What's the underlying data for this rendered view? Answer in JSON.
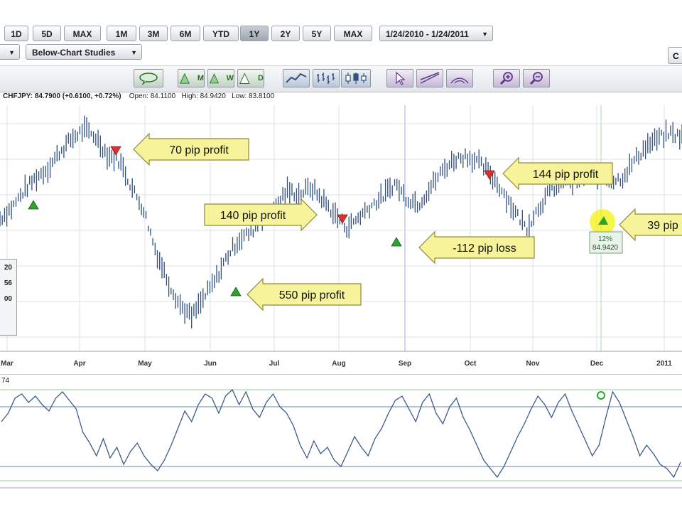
{
  "range_buttons": [
    "1D",
    "5D",
    "MAX",
    "1M",
    "3M",
    "6M",
    "YTD",
    "1Y",
    "2Y",
    "5Y",
    "MAX"
  ],
  "active_range": "1Y",
  "date_range": "1/24/2010 - 1/24/2011",
  "studies_dropdown": "Below-Chart Studies",
  "corner_tab": "C",
  "toolbar": {
    "m": "M",
    "w": "W",
    "d": "D"
  },
  "quote": {
    "symbol": "CHFJPY: 84.7900 (+0.6100, +0.72%)",
    "open": "Open: 84.1100",
    "high": "High: 84.9420",
    "low": "Low: 83.8100"
  },
  "left_panel": [
    "20",
    "56",
    "00"
  ],
  "osc_label": "74",
  "colors": {
    "price": "#2f4f7f",
    "buy": "#2aa52a",
    "sell": "#d93030",
    "callout": "#f6f39a",
    "grid": "#dde3ea",
    "cursor": "#b8b8e8",
    "osc": "#3a5a8a"
  },
  "chart_data": {
    "type": "line",
    "x_ticks": [
      "Mar",
      "Apr",
      "May",
      "Jun",
      "Jul",
      "Aug",
      "Sep",
      "Oct",
      "Nov",
      "Dec",
      "2011"
    ],
    "price_series": [
      82.9,
      83.5,
      84.4,
      85.1,
      85.6,
      86.5,
      87.2,
      87.7,
      87.3,
      86.3,
      86.0,
      84.6,
      83.4,
      81.2,
      79.6,
      78.3,
      77.6,
      78.6,
      79.6,
      80.9,
      81.8,
      82.2,
      83.0,
      83.6,
      84.4,
      84.2,
      84.6,
      83.9,
      83.1,
      82.4,
      83.0,
      83.6,
      84.1,
      84.8,
      84.0,
      83.7,
      84.6,
      85.5,
      86.1,
      86.3,
      85.9,
      85.3,
      84.4,
      83.3,
      82.4,
      83.5,
      84.4,
      84.9,
      84.8,
      85.3,
      85.2,
      84.9,
      85.1,
      86.0,
      86.8,
      87.2,
      87.5,
      87.3
    ],
    "oscillator_series": [
      62,
      70,
      84,
      88,
      80,
      86,
      78,
      72,
      84,
      90,
      82,
      74,
      52,
      42,
      30,
      46,
      28,
      38,
      22,
      34,
      42,
      30,
      22,
      16,
      26,
      40,
      56,
      72,
      62,
      78,
      88,
      84,
      70,
      86,
      92,
      78,
      90,
      74,
      66,
      80,
      88,
      76,
      70,
      58,
      40,
      28,
      44,
      32,
      38,
      26,
      20,
      34,
      48,
      38,
      30,
      46,
      56,
      70,
      82,
      86,
      74,
      62,
      80,
      88,
      70,
      60,
      76,
      84,
      66,
      54,
      40,
      26,
      18,
      10,
      20,
      34,
      48,
      60,
      74,
      86,
      78,
      66,
      80,
      88,
      72,
      58,
      44,
      30,
      40,
      66,
      90,
      80,
      64,
      48,
      30,
      40,
      32,
      22,
      18,
      10,
      24
    ],
    "annotations": [
      {
        "text": "70 pip profit",
        "signal": "sell",
        "direction": "left"
      },
      {
        "text": "140 pip profit",
        "signal": "sell",
        "direction": "right"
      },
      {
        "text": "550 pip profit",
        "signal": "buy",
        "direction": "left"
      },
      {
        "text": "-112 pip loss",
        "signal": "buy",
        "direction": "left"
      },
      {
        "text": "144 pip profit",
        "signal": "sell",
        "direction": "left"
      },
      {
        "text": "39 pip",
        "signal": "buy",
        "direction": "left"
      }
    ],
    "marker_label": "12%",
    "marker_price": "84.9420"
  }
}
